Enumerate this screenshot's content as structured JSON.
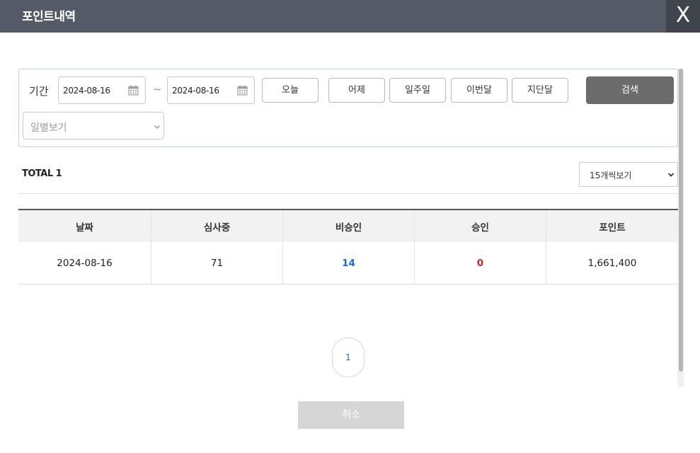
{
  "header": {
    "title": "포인트내역",
    "close_label": "X"
  },
  "filter": {
    "period_label": "기간",
    "start_date": "2024-08-16",
    "separator": "~",
    "end_date": "2024-08-16",
    "quick_buttons": [
      "오늘",
      "어제",
      "일주일",
      "이번달",
      "지단달"
    ],
    "search_label": "검색",
    "view_mode": "일별보기"
  },
  "summary": {
    "total_label": "TOTAL 1",
    "page_size": "15개씩보기"
  },
  "table": {
    "columns": [
      "날짜",
      "심사중",
      "비승인",
      "승인",
      "포인트"
    ],
    "rows": [
      [
        "2024-08-16",
        "71",
        "14",
        "0",
        "1,661,400"
      ]
    ]
  },
  "pagination": {
    "current": "1"
  },
  "footer": {
    "cancel_label": "취소"
  },
  "colors": {
    "header_bg": "#545b66",
    "accent_blue": "#1a6bd0",
    "accent_red": "#c62828",
    "search_bg": "#6c6c6c"
  },
  "icons": {
    "calendar": "calendar-icon",
    "dropdown": "chevron-down-icon",
    "close": "close-icon"
  }
}
